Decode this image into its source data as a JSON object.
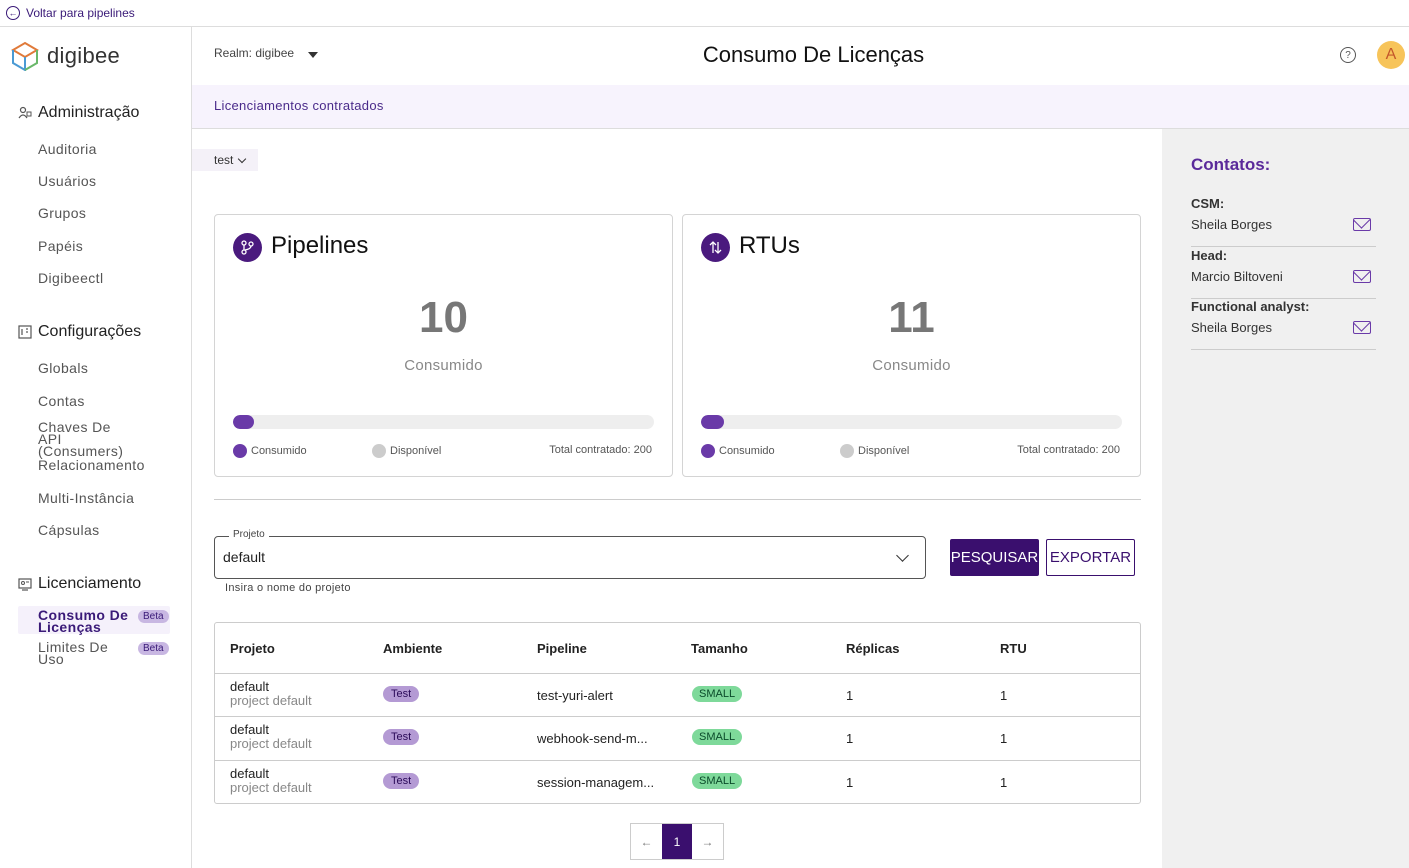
{
  "topbar": {
    "back_label": "Voltar para pipelines"
  },
  "logo": {
    "text": "digibee"
  },
  "sidebar": {
    "sections": [
      {
        "title": "Administração",
        "items": [
          "Auditoria",
          "Usuários",
          "Grupos",
          "Papéis",
          "Digibeectl"
        ]
      },
      {
        "title": "Configurações",
        "items": [
          "Globals",
          "Contas",
          "Chaves De API (Consumers)",
          "Relacionamento",
          "Multi-Instância",
          "Cápsulas"
        ]
      },
      {
        "title": "Licenciamento",
        "items": [
          "Consumo De Licenças",
          "Limites De Uso"
        ]
      }
    ],
    "beta_label": "Beta"
  },
  "header": {
    "realm_label": "Realm: digibee",
    "title": "Consumo De Licenças",
    "avatar_initial": "A"
  },
  "subheader": {
    "label": "Licenciamentos contratados"
  },
  "tenant": {
    "label": "test"
  },
  "cards": [
    {
      "title": "Pipelines",
      "value": "10",
      "subtitle": "Consumido",
      "consumed_fraction": 0.05,
      "legend_consumed": "Consumido",
      "legend_available": "Disponível",
      "total": "Total contratado: 200"
    },
    {
      "title": "RTUs",
      "value": "11",
      "subtitle": "Consumido",
      "consumed_fraction": 0.055,
      "legend_consumed": "Consumido",
      "legend_available": "Disponível",
      "total": "Total contratado: 200"
    }
  ],
  "colors": {
    "accent": "#3a0f6e",
    "consumed": "#6a3aa8",
    "available": "#cccccc"
  },
  "search": {
    "legend": "Projeto",
    "value": "default",
    "helper": "Insira o nome do projeto",
    "search_button": "PESQUISAR",
    "export_button": "EXPORTAR"
  },
  "table": {
    "headers": [
      "Projeto",
      "Ambiente",
      "Pipeline",
      "Tamanho",
      "Réplicas",
      "RTU"
    ],
    "rows": [
      {
        "project": "default",
        "project_desc": "project default",
        "env": "Test",
        "pipeline": "test-yuri-alert",
        "size": "SMALL",
        "replicas": "1",
        "rtu": "1"
      },
      {
        "project": "default",
        "project_desc": "project default",
        "env": "Test",
        "pipeline": "webhook-send-m...",
        "size": "SMALL",
        "replicas": "1",
        "rtu": "1"
      },
      {
        "project": "default",
        "project_desc": "project default",
        "env": "Test",
        "pipeline": "session-managem...",
        "size": "SMALL",
        "replicas": "1",
        "rtu": "1"
      }
    ]
  },
  "pagination": {
    "prev": "←",
    "current": "1",
    "next": "→"
  },
  "contacts": {
    "title": "Contatos:",
    "items": [
      {
        "role": "CSM:",
        "name": "Sheila Borges"
      },
      {
        "role": "Head:",
        "name": "Marcio Biltoveni"
      },
      {
        "role": "Functional analyst:",
        "name": "Sheila Borges"
      }
    ]
  }
}
